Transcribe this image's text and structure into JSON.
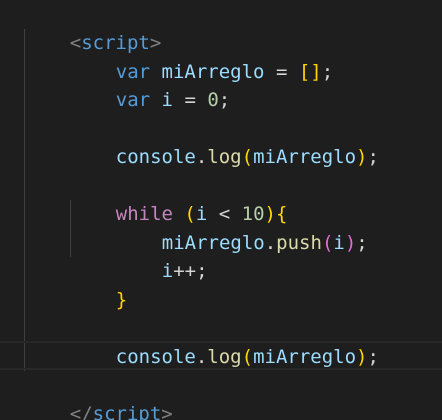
{
  "colors": {
    "background": "#1e1e1e",
    "tag": "#569cd6",
    "punctuation": "#808080",
    "keyword": "#569cd6",
    "identifier": "#9cdcfe",
    "number": "#b5cea8",
    "bracket_level1": "#ffd700",
    "bracket_level2": "#da70d6",
    "function": "#dcdcaa",
    "text": "#d4d4d4"
  },
  "code": {
    "open_tag": {
      "lt": "<",
      "name": "script",
      "gt": ">"
    },
    "line_var_arreglo": {
      "kw": "var",
      "name": "miArreglo",
      "op": " = ",
      "open": "[",
      "close": "]",
      "end": ";"
    },
    "line_var_i": {
      "kw": "var",
      "name": "i",
      "op": " = ",
      "num": "0",
      "end": ";"
    },
    "line_log_1": {
      "obj": "console",
      "dot": ".",
      "fn": "log",
      "open": "(",
      "arg": "miArreglo",
      "close": ")",
      "end": ";"
    },
    "line_while": {
      "kw": "while",
      "open": "(",
      "var": "i",
      "op": " < ",
      "num": "10",
      "close": ")",
      "brace": "{"
    },
    "line_push": {
      "obj": "miArreglo",
      "dot": ".",
      "fn": "push",
      "open": "(",
      "arg": "i",
      "close": ")",
      "end": ";"
    },
    "line_incr": {
      "var": "i",
      "op": "++",
      "end": ";"
    },
    "line_close_brace": {
      "brace": "}"
    },
    "line_log_2": {
      "obj": "console",
      "dot": ".",
      "fn": "log",
      "open": "(",
      "arg": "miArreglo",
      "close": ")",
      "end": ";"
    },
    "close_tag": {
      "lt": "</",
      "name": "script",
      "gt": ">"
    }
  }
}
